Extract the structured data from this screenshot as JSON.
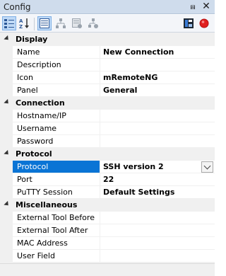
{
  "window": {
    "title": "Config",
    "pin_glyph": "⩎",
    "close_glyph": "✕"
  },
  "toolbar": {
    "buttons": [
      {
        "icon": "categorized-view-icon",
        "active": true
      },
      {
        "icon": "alphabetical-sort-icon",
        "active": false
      },
      {
        "icon": "properties-icon",
        "active": true
      },
      {
        "icon": "inheritance-icon",
        "active": false
      },
      {
        "icon": "default-properties-icon",
        "active": false
      },
      {
        "icon": "default-inheritance-icon",
        "active": false
      },
      {
        "icon": "host-status-icon",
        "active": false
      },
      {
        "icon": "stop-icon",
        "active": false
      }
    ]
  },
  "categories": [
    {
      "label": "Display",
      "props": [
        {
          "name": "Name",
          "value": "New Connection"
        },
        {
          "name": "Description",
          "value": ""
        },
        {
          "name": "Icon",
          "value": "mRemoteNG"
        },
        {
          "name": "Panel",
          "value": "General"
        }
      ]
    },
    {
      "label": "Connection",
      "props": [
        {
          "name": "Hostname/IP",
          "value": ""
        },
        {
          "name": "Username",
          "value": ""
        },
        {
          "name": "Password",
          "value": ""
        }
      ]
    },
    {
      "label": "Protocol",
      "props": [
        {
          "name": "Protocol",
          "value": "SSH version 2",
          "selected": true
        },
        {
          "name": "Port",
          "value": "22"
        },
        {
          "name": "PuTTY Session",
          "value": "Default Settings"
        }
      ]
    },
    {
      "label": "Miscellaneous",
      "props": [
        {
          "name": "External Tool Before",
          "value": ""
        },
        {
          "name": "External Tool After",
          "value": ""
        },
        {
          "name": "MAC Address",
          "value": ""
        },
        {
          "name": "User Field",
          "value": ""
        }
      ]
    }
  ],
  "colors": {
    "selection": "#0a74d5",
    "titlebar": "#cfdcec",
    "stop": "#e01f1f"
  }
}
